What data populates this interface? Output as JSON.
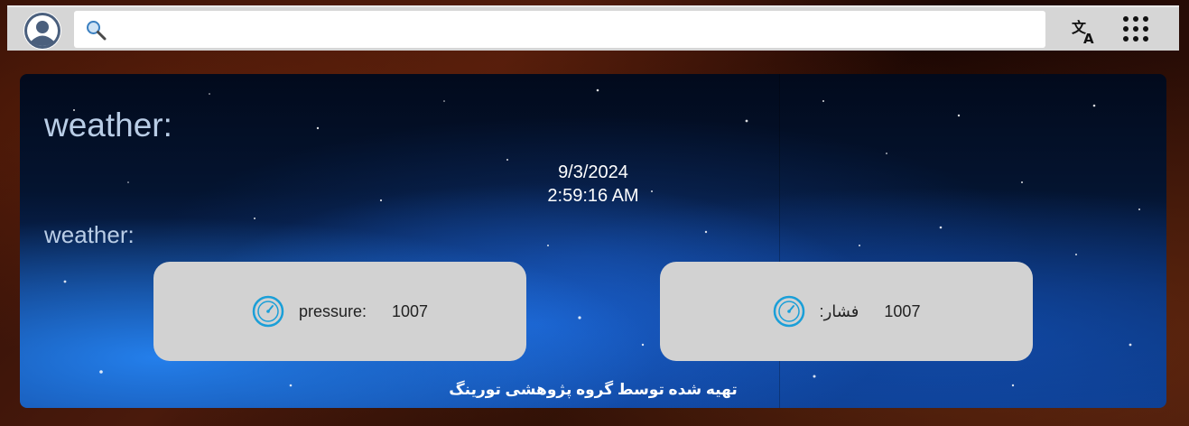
{
  "header": {
    "search": {
      "value": "",
      "placeholder": ""
    },
    "icons": {
      "avatar": "user-avatar-icon",
      "search": "search-icon",
      "translate": "translate-icon",
      "apps": "apps-grid-icon"
    }
  },
  "panel": {
    "title": "weather:",
    "date": "9/3/2024",
    "time": "2:59:16 AM",
    "subtitle": "weather:",
    "cards": [
      {
        "label": "pressure:",
        "value": "1007",
        "icon": "gauge-icon"
      },
      {
        "label": ":فشار",
        "value": "1007",
        "icon": "gauge-icon"
      }
    ],
    "footer": "تهیه شده توسط گروه پژوهشی تورینگ"
  },
  "colors": {
    "topbar_bg": "#d6d6d6",
    "card_bg": "#d2d2d2",
    "title_color": "#b9cde6",
    "icon_blue": "#1a9fd8"
  }
}
